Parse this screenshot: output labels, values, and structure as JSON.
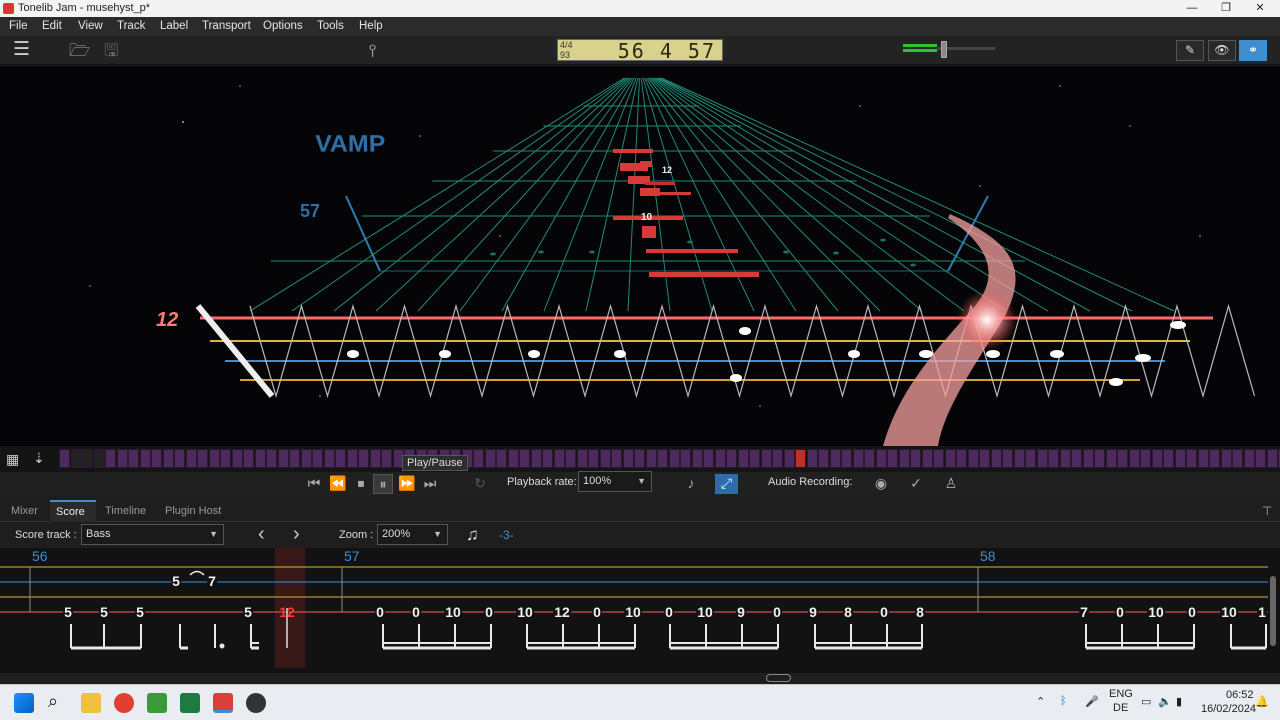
{
  "window": {
    "title": "Tonelib Jam - musehyst_p*",
    "minimize": "—",
    "maximize": "❐",
    "close": "✕"
  },
  "menu": [
    "File",
    "Edit",
    "View",
    "Track",
    "Label",
    "Transport",
    "Options",
    "Tools",
    "Help"
  ],
  "toolbar": {
    "hamburger": "☰",
    "open": "🗁",
    "save": "🖫",
    "tuner": "⫯",
    "lcd": {
      "signature": "4/4",
      "tempo": "93",
      "position": "56 4 57"
    },
    "modes": [
      "✎",
      "👁",
      "⚭"
    ]
  },
  "view3d": {
    "section_label": "VAMP",
    "upcoming_bar": "57",
    "current_fret": "12",
    "note_labels": [
      "12",
      "10"
    ]
  },
  "transport": {
    "tooltip": "Play/Pause",
    "buttons": [
      "⏮",
      "⏪",
      "⏹",
      "⏸",
      "⏩",
      "⏭"
    ],
    "loop": "↻",
    "playback_rate_label": "Playback rate:",
    "playback_rate_value": "100%",
    "audio_recording_label": "Audio Recording:",
    "metronome": "♪",
    "countin": "⤢",
    "rec": "◉",
    "check": "✓",
    "monitor": "♙"
  },
  "tabs": [
    "Mixer",
    "Score",
    "Timeline",
    "Plugin Host"
  ],
  "active_tab": "Score",
  "scorebar": {
    "score_track_label": "Score track :",
    "score_track_value": "Bass",
    "prev": "‹",
    "next": "›",
    "zoom_label": "Zoom :",
    "zoom_value": "200%",
    "note_icon": "♫",
    "transpose": "-3-"
  },
  "score": {
    "bars": [
      "56",
      "57",
      "58"
    ],
    "upper_notes": [
      "5",
      "7"
    ],
    "notes": [
      "5",
      "5",
      "5",
      "5",
      "12",
      "0",
      "0",
      "10",
      "0",
      "10",
      "12",
      "0",
      "10",
      "0",
      "10",
      "9",
      "0",
      "9",
      "8",
      "0",
      "8",
      "7",
      "0",
      "10",
      "0",
      "10",
      "1"
    ]
  },
  "taskbar": {
    "lang": "ENG",
    "layout": "DE",
    "time": "06:52",
    "date": "16/02/2024"
  },
  "colors": {
    "accent": "#3e8ed0",
    "string_red": "#ff5a5a",
    "string_yellow": "#d8b63a",
    "string_blue": "#3a8fd8",
    "grid": "#2bb79a",
    "timeline_cell": "#4c2a5e",
    "playhead": "#c0302a"
  }
}
